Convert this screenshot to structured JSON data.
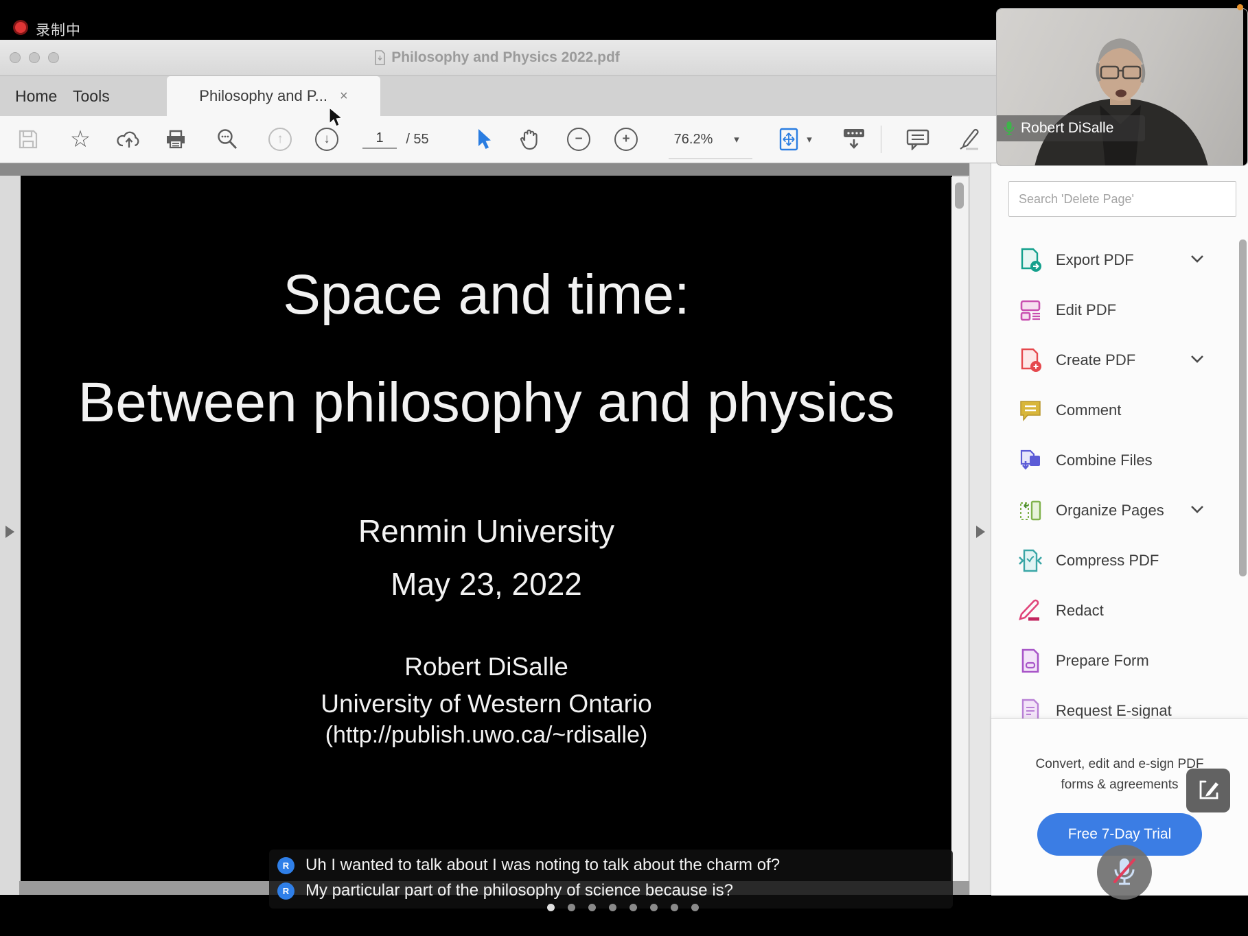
{
  "recording": {
    "label": "录制中"
  },
  "window": {
    "title": "Philosophy and Physics 2022.pdf"
  },
  "tabs": {
    "home": "Home",
    "tools": "Tools",
    "document_tab": "Philosophy and P...",
    "close": "×"
  },
  "toolbar": {
    "page_current": "1",
    "page_total": "/ 55",
    "zoom_value": "76.2%",
    "icons": [
      "save-icon",
      "star-icon",
      "cloud-upload-icon",
      "print-icon",
      "search-icon",
      "page-up-icon",
      "page-down-icon",
      "select-tool-icon",
      "hand-tool-icon",
      "zoom-out-icon",
      "zoom-in-icon",
      "fit-page-icon",
      "toolbar-hide-icon",
      "comment-icon",
      "highlighter-icon"
    ]
  },
  "slide": {
    "title_line1": "Space and time:",
    "title_line2": "Between philosophy and physics",
    "venue": "Renmin University",
    "date": "May 23, 2022",
    "author": "Robert DiSalle",
    "affiliation": "University of Western Ontario",
    "url": "(http://publish.uwo.ca/~rdisalle)"
  },
  "sidebar": {
    "search_placeholder": "Search 'Delete Page'",
    "items": [
      {
        "label": "Export PDF",
        "icon": "export-pdf-icon",
        "chevron": true
      },
      {
        "label": "Edit PDF",
        "icon": "edit-pdf-icon",
        "chevron": false
      },
      {
        "label": "Create PDF",
        "icon": "create-pdf-icon",
        "chevron": true
      },
      {
        "label": "Comment",
        "icon": "comment-icon",
        "chevron": false
      },
      {
        "label": "Combine Files",
        "icon": "combine-files-icon",
        "chevron": false
      },
      {
        "label": "Organize Pages",
        "icon": "organize-pages-icon",
        "chevron": true
      },
      {
        "label": "Compress PDF",
        "icon": "compress-pdf-icon",
        "chevron": false
      },
      {
        "label": "Redact",
        "icon": "redact-icon",
        "chevron": false
      },
      {
        "label": "Prepare Form",
        "icon": "prepare-form-icon",
        "chevron": false
      },
      {
        "label": "Request E-signat",
        "icon": "request-esign-icon",
        "chevron": false
      }
    ],
    "promo_line1": "Convert, edit and e-sign PDF",
    "promo_line2": "forms & agreements",
    "trial_button": "Free 7-Day Trial"
  },
  "webcam": {
    "name": "Robert DiSalle"
  },
  "captions": {
    "lines": [
      {
        "avatar": "R",
        "text": "Uh I wanted to talk about I was noting to talk about the charm of?"
      },
      {
        "avatar": "R",
        "text": "My particular part of the philosophy of science because is?"
      }
    ],
    "dots_count": 8,
    "active_dot": 0
  },
  "colors": {
    "tool_accent_blue": "#2a7de1",
    "trial_blue": "#3b7de4",
    "record_red": "#e03535",
    "avatar_blue": "#2f7fe8",
    "mic_green": "#3db54a",
    "export_teal": "#14a08c",
    "edit_magenta": "#c94fb0",
    "create_red": "#e5484d",
    "comment_gold": "#cfa52e",
    "combine_indigo": "#5b5bd6",
    "organize_green": "#7fb24b",
    "compress_teal": "#3aa6a6",
    "redact_pink": "#e0447a",
    "form_purple": "#a855c8",
    "esign_purple": "#b980d6"
  }
}
